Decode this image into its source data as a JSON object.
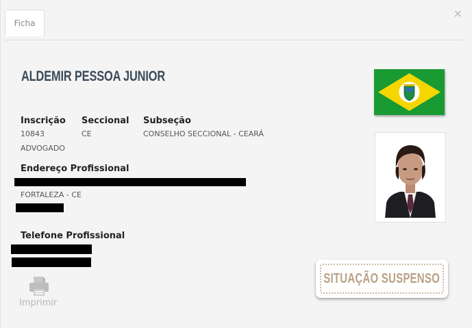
{
  "tabs": [
    {
      "label": "Ficha",
      "active": true
    }
  ],
  "close_icon": "close-icon",
  "profile": {
    "name": "ALDEMIR PESSOA JUNIOR",
    "inscricao_label": "Inscrição",
    "inscricao_value": "10843",
    "seccional_label": "Seccional",
    "seccional_value": "CE",
    "subsecao_label": "Subseção",
    "subsecao_value": "CONSELHO SECCIONAL - CEARÁ",
    "category": "ADVOGADO",
    "endereco_label": "Endereço Profissional",
    "city": "FORTALEZA - CE",
    "telefone_label": "Telefone Profissional"
  },
  "actions": {
    "print_label": "Imprimir",
    "print_icon": "printer-icon"
  },
  "status": {
    "label": "SITUAÇÃO SUSPENSO"
  },
  "colors": {
    "name": "#3a4a58",
    "status_text": "#b9a186",
    "status_border": "#c9b8a2",
    "flag_green": "#1a9a33",
    "flag_yellow": "#f6d600"
  }
}
